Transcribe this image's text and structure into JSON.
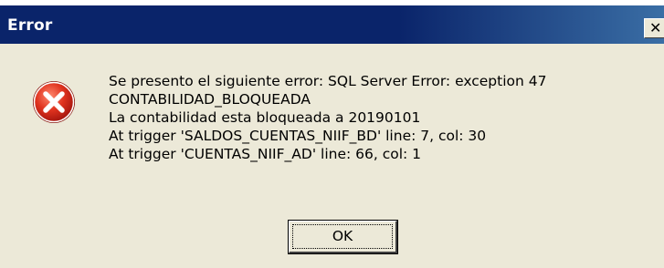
{
  "window": {
    "title": "Error",
    "close_glyph": "✕"
  },
  "icon": {
    "name": "error-icon",
    "color": "#d9281d"
  },
  "message": {
    "lines": [
      "Se presento el siguiente error: SQL Server Error: exception 47",
      "CONTABILIDAD_BLOQUEADA",
      "La contabilidad esta bloqueada a 20190101",
      "At trigger 'SALDOS_CUENTAS_NIIF_BD' line: 7, col: 30",
      "At trigger 'CUENTAS_NIIF_AD' line: 66, col: 1"
    ]
  },
  "buttons": {
    "ok_label": "OK"
  },
  "colors": {
    "titlebar": "#0a246a",
    "dialog_bg": "#ece9d8"
  }
}
